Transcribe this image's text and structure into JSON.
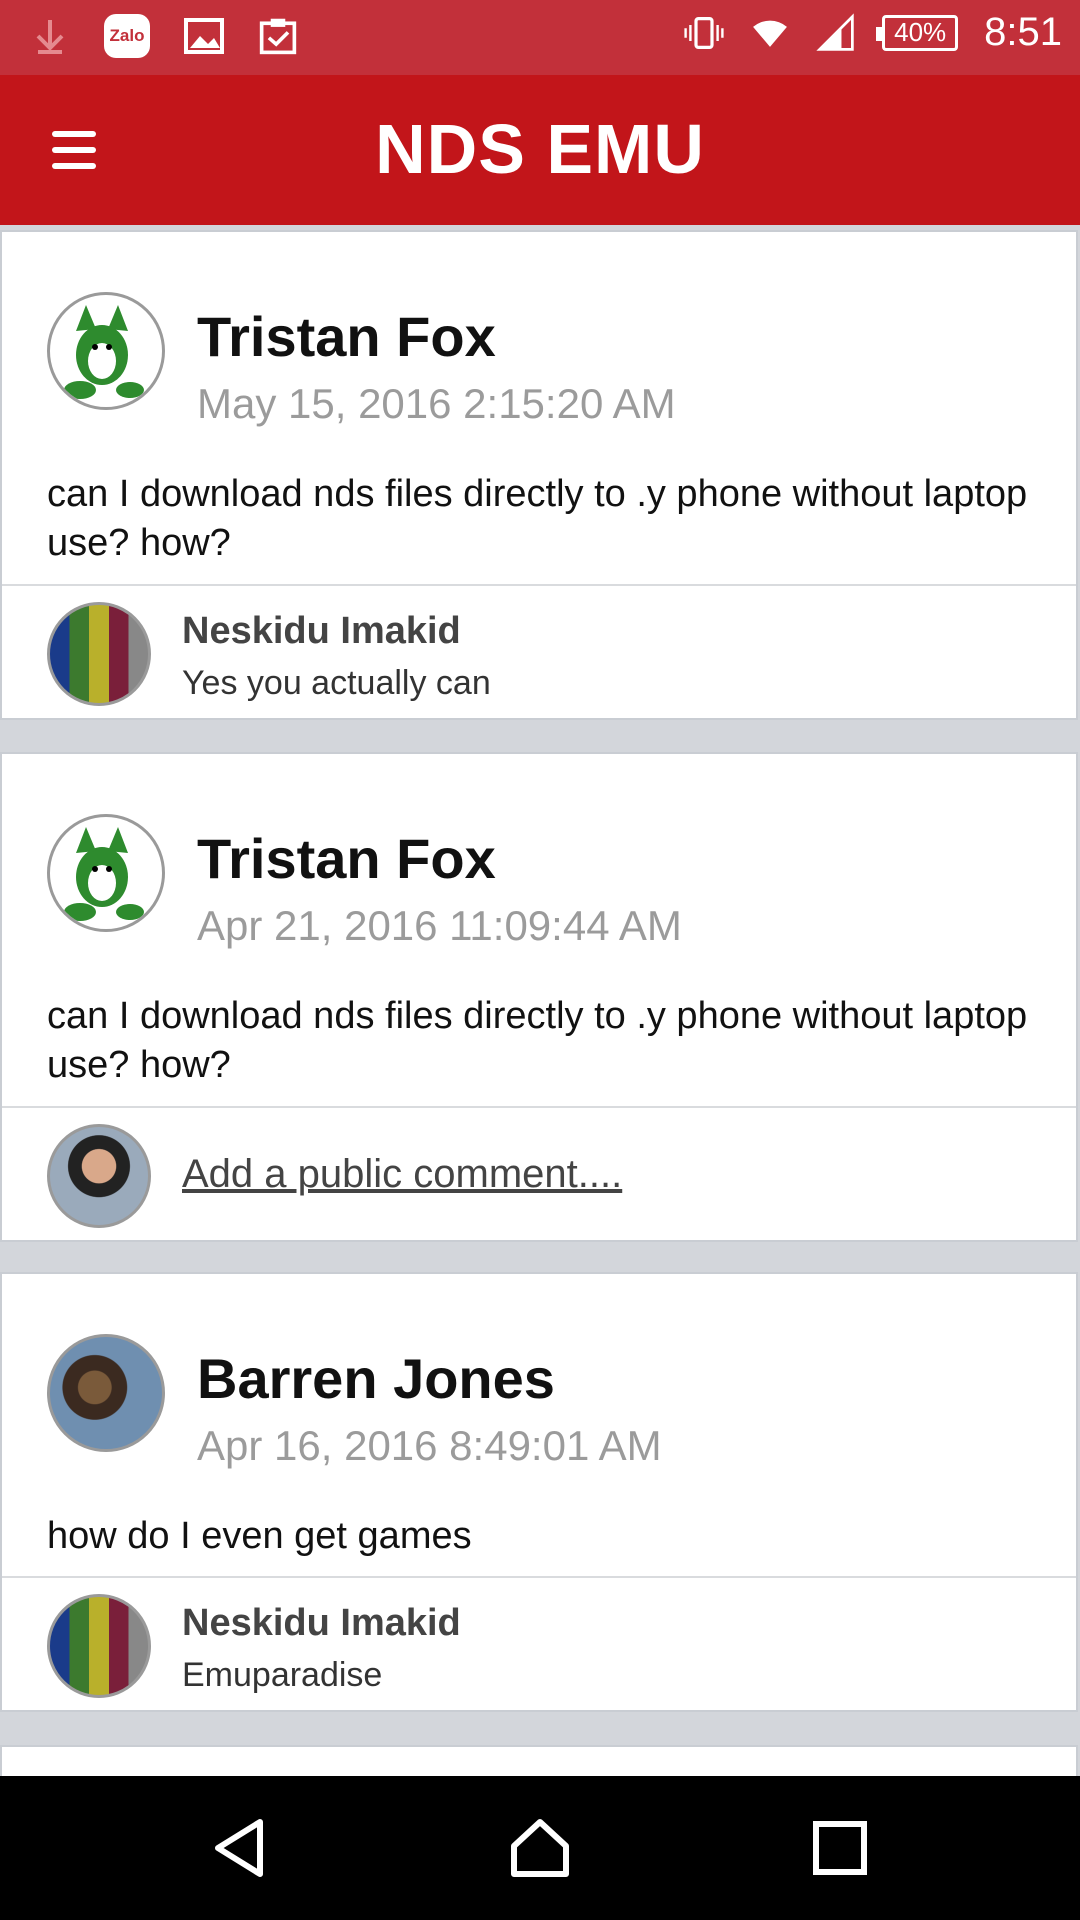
{
  "status_bar": {
    "left_icons": [
      "download-arrow-icon",
      "zalo-icon",
      "image-icon",
      "clipboard-check-icon"
    ],
    "zalo_label": "Zalo",
    "right_icons": [
      "vibrate-icon",
      "wifi-icon",
      "signal-icon"
    ],
    "battery": "40%",
    "time": "8:51"
  },
  "app_bar": {
    "title": "NDS EMU",
    "menu_icon": "hamburger-menu-icon"
  },
  "colors": {
    "status_bar": "#c2303a",
    "app_bar": "#c2151a",
    "background": "#d3d6db"
  },
  "posts": [
    {
      "author": "Tristan Fox",
      "date": "May 15, 2016 2:15:20 AM",
      "body": "can I download nds files directly to .y phone without laptop use? how?",
      "reply": {
        "name": "Neskidu Imakid",
        "text": "Yes you actually can"
      }
    },
    {
      "author": "Tristan Fox",
      "date": "Apr 21, 2016 11:09:44 AM",
      "body": "can I download nds files directly to .y phone without laptop use? how?",
      "comment_placeholder": "Add a public comment...."
    },
    {
      "author": "Barren Jones",
      "date": "Apr 16, 2016 8:49:01 AM",
      "body": "how do I even get games",
      "reply": {
        "name": "Neskidu Imakid",
        "text": "Emuparadise"
      }
    }
  ],
  "nav_bar": {
    "icons": [
      "back-icon",
      "home-icon",
      "recents-icon"
    ]
  }
}
